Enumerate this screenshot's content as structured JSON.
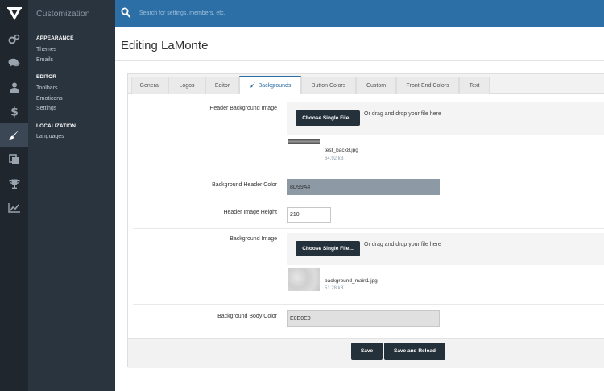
{
  "colors": {
    "rail": "#1f262d",
    "sidebar": "#2a343e",
    "topbar": "#2c6fa6",
    "button": "#24303a",
    "header_bg_swatch": "#8D99A4",
    "body_bg_swatch": "#E0E0E0"
  },
  "rail_icons": [
    "logo-icon",
    "cogs-icon",
    "comments-icon",
    "user-icon",
    "dollar-icon",
    "brush-icon",
    "copy-icon",
    "trophy-icon",
    "chart-icon"
  ],
  "sidebar": {
    "title": "Customization",
    "groups": [
      {
        "label": "APPEARANCE",
        "items": [
          "Themes",
          "Emails"
        ]
      },
      {
        "label": "EDITOR",
        "items": [
          "Toolbars",
          "Emoticons",
          "Settings"
        ]
      },
      {
        "label": "LOCALIZATION",
        "items": [
          "Languages"
        ]
      }
    ]
  },
  "search": {
    "placeholder": "Search for settings, members, etc."
  },
  "page": {
    "title": "Editing LaMonte"
  },
  "tabs": [
    "General",
    "Logos",
    "Editor",
    "Backgrounds",
    "Button Colors",
    "Custom",
    "Front-End Colors",
    "Text"
  ],
  "form": {
    "header_bg_image": {
      "label": "Header Background Image",
      "button": "Choose Single File...",
      "drop": "Or drag and drop your file here",
      "file_name": "test_back8.jpg",
      "file_size": "64.92 kB"
    },
    "header_color": {
      "label": "Background Header Color",
      "value": "8D99A4"
    },
    "header_height": {
      "label": "Header Image Height",
      "value": "210"
    },
    "bg_image": {
      "label": "Background Image",
      "button": "Choose Single File...",
      "drop": "Or drag and drop your file here",
      "file_name": "background_main1.jpg",
      "file_size": "51.28 kB"
    },
    "body_color": {
      "label": "Background Body Color",
      "value": "E0E0E0"
    }
  },
  "actions": {
    "save": "Save",
    "save_reload": "Save and Reload"
  }
}
